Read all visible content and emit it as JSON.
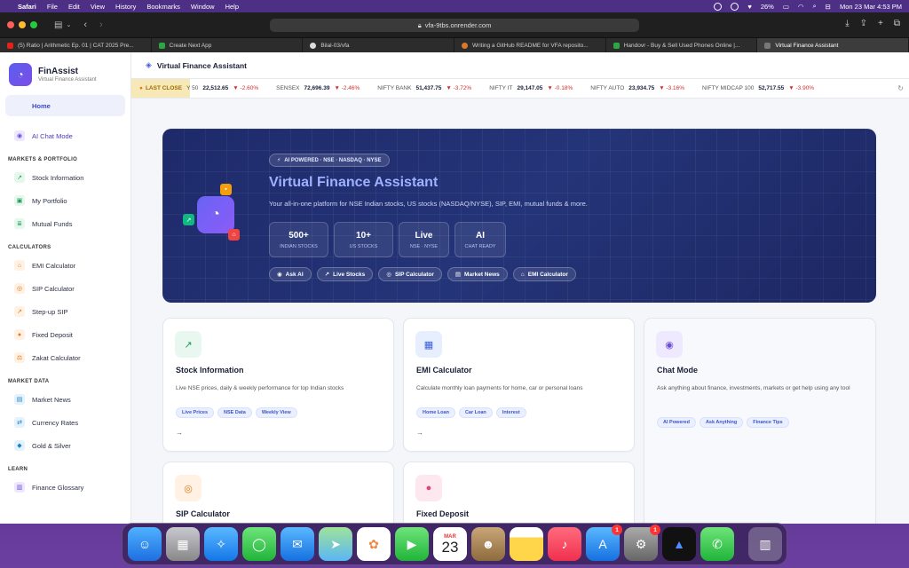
{
  "menubar": {
    "app": "Safari",
    "items": [
      "File",
      "Edit",
      "View",
      "History",
      "Bookmarks",
      "Window",
      "Help"
    ],
    "battery": "26%",
    "clock": "Mon 23 Mar  4:53 PM"
  },
  "browser": {
    "url": "vfa-9tbs.onrender.com",
    "tabs": [
      {
        "label": "(5) Ratio | Arithmetic Ep. 01 | CAT 2025 Pre...",
        "color": "#e62117"
      },
      {
        "label": "Create Next App",
        "color": "#29a745"
      },
      {
        "label": "Bilal-03/vfa",
        "color": "#dddddd"
      },
      {
        "label": "Writing a GitHub README for VFA reposito...",
        "color": "#d97a2b"
      },
      {
        "label": "Handovr - Buy & Sell Used Phones Online |...",
        "color": "#29a745"
      },
      {
        "label": "Virtual Finance Assistant",
        "color": "#777777"
      }
    ]
  },
  "brand": {
    "name": "FinAssist",
    "sub": "Virtual Finance Assistant"
  },
  "sidebar": {
    "home": "Home",
    "chat": "AI Chat Mode",
    "sec1": "MARKETS & PORTFOLIO",
    "stock": "Stock Information",
    "portfolio": "My Portfolio",
    "mutual": "Mutual Funds",
    "sec2": "CALCULATORS",
    "emi": "EMI Calculator",
    "sip": "SIP Calculator",
    "stepup": "Step-up SIP",
    "fd": "Fixed Deposit",
    "zakat": "Zakat Calculator",
    "sec3": "MARKET DATA",
    "news": "Market News",
    "currency": "Currency Rates",
    "gold": "Gold & Silver",
    "sec4": "LEARN",
    "glossary": "Finance Glossary"
  },
  "header": {
    "title": "Virtual Finance Assistant"
  },
  "ticker": {
    "label": "LAST CLOSE",
    "items": [
      {
        "name": "Y 50",
        "value": "22,512.65",
        "change": "▼ -2.60%"
      },
      {
        "name": "SENSEX",
        "value": "72,696.39",
        "change": "▼ -2.46%"
      },
      {
        "name": "NIFTY BANK",
        "value": "51,437.75",
        "change": "▼ -3.72%"
      },
      {
        "name": "NIFTY IT",
        "value": "29,147.05",
        "change": "▼ -0.18%"
      },
      {
        "name": "NIFTY AUTO",
        "value": "23,934.75",
        "change": "▼ -3.16%"
      },
      {
        "name": "NIFTY MIDCAP 100",
        "value": "52,717.55",
        "change": "▼ -3.90%"
      }
    ]
  },
  "hero": {
    "badge": "AI POWERED · NSE · NASDAQ · NYSE",
    "title": "Virtual Finance Assistant",
    "subtitle": "Your all-in-one platform for NSE Indian stocks, US stocks (NASDAQ/NYSE), SIP, EMI, mutual funds & more.",
    "stats": [
      {
        "value": "500+",
        "label": "INDIAN STOCKS"
      },
      {
        "value": "10+",
        "label": "US STOCKS"
      },
      {
        "value": "Live",
        "label": "NSE · NYSE"
      },
      {
        "value": "AI",
        "label": "CHAT READY"
      }
    ],
    "pills": [
      "Ask AI",
      "Live Stocks",
      "SIP Calculator",
      "Market News",
      "EMI Calculator"
    ]
  },
  "cards": {
    "stock": {
      "title": "Stock Information",
      "desc": "Live NSE prices, daily & weekly performance for top Indian stocks",
      "tags": [
        "Live Prices",
        "NSE Data",
        "Weekly View"
      ],
      "arrow": "→"
    },
    "emi": {
      "title": "EMI Calculator",
      "desc": "Calculate monthly loan payments for home, car or personal loans",
      "tags": [
        "Home Loan",
        "Car Loan",
        "Interest"
      ],
      "arrow": "→"
    },
    "chat": {
      "title": "Chat Mode",
      "desc": "Ask anything about finance, investments, markets or get help using any tool",
      "tags": [
        "AI Powered",
        "Ask Anything",
        "Finance Tips"
      ]
    },
    "sip": {
      "title": "SIP Calculator"
    },
    "fd": {
      "title": "Fixed Deposit"
    }
  },
  "dock": {
    "calendar_month": "MAR",
    "calendar_day": "23",
    "appstore_badge": "1",
    "settings_badge": "1"
  }
}
